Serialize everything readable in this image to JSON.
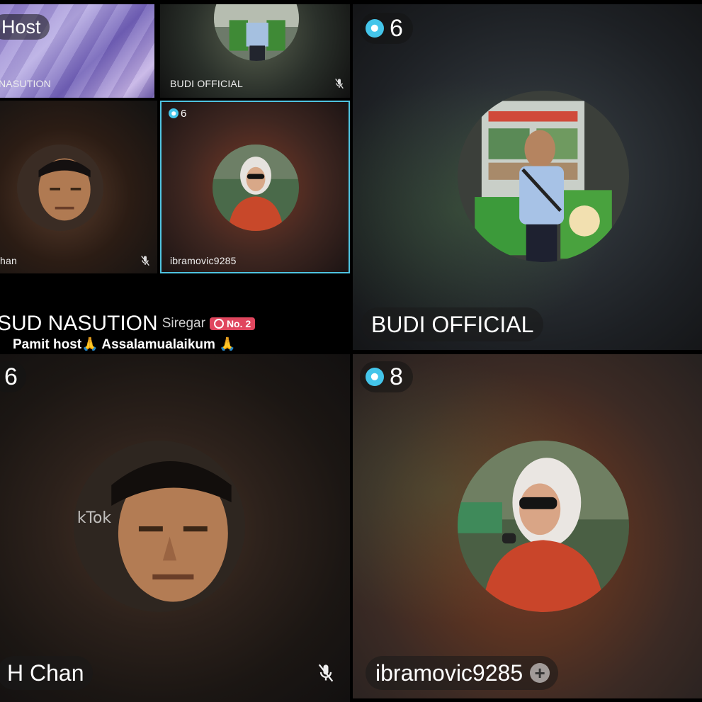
{
  "thumbnails": {
    "host_label": "Host",
    "tile_a_name": "NASUTION",
    "tile_b_name": "BUDI OFFICIAL",
    "tile_c_name": "han",
    "tile_d_name": "ibramovic9285",
    "tile_d_level": "6"
  },
  "chat": {
    "overlay_name": "SUD NASUTION",
    "sender_suffix": "Siregar",
    "rank_badge": "No. 2",
    "message": "Pamit host🙏 Assalamualaikum 🙏"
  },
  "tiles": [
    {
      "id": "budi",
      "level": "6",
      "name": "BUDI OFFICIAL"
    },
    {
      "id": "chan",
      "level": "6",
      "name": "H Chan",
      "muted": true
    },
    {
      "id": "ibramovic",
      "level": "8",
      "name": "ibramovic9285",
      "action": "add"
    }
  ],
  "colors": {
    "level_badge": "#44c5ea",
    "active_border": "#4fc3e0",
    "rank_badge": "#e0465e"
  },
  "icons": [
    "level-badge-icon",
    "mic-muted-icon",
    "add-icon"
  ]
}
